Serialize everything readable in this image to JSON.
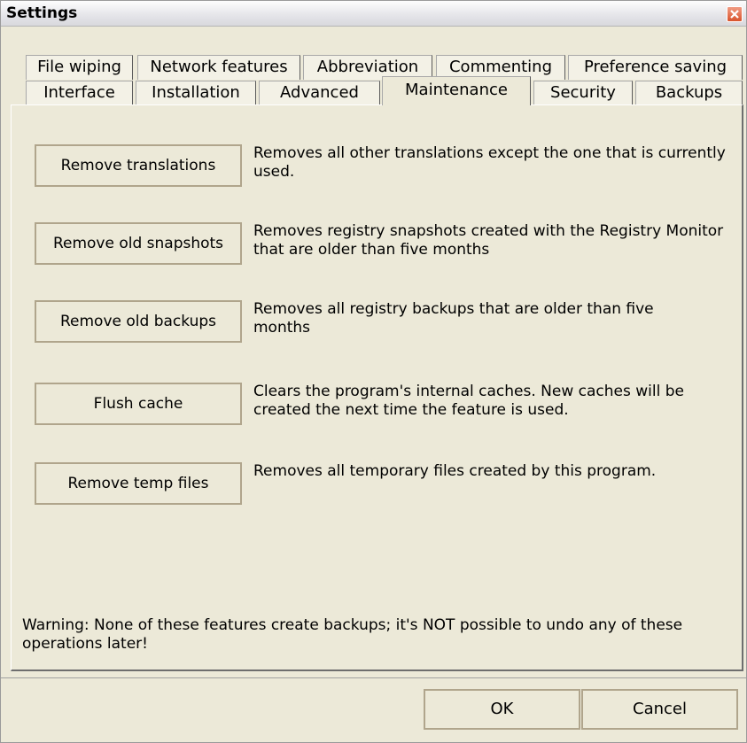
{
  "window": {
    "title": "Settings"
  },
  "tabs_row1": [
    "File wiping",
    "Network features",
    "Abbreviation",
    "Commenting",
    "Preference saving"
  ],
  "tabs_row2": [
    "Interface",
    "Installation",
    "Advanced",
    "Maintenance",
    "Security",
    "Backups"
  ],
  "active_tab": "Maintenance",
  "actions": [
    {
      "label": "Remove translations",
      "description": "Removes all other translations except the one that is currently used."
    },
    {
      "label": "Remove old snapshots",
      "description": "Removes registry snapshots created with the Registry Monitor that are older than five months"
    },
    {
      "label": "Remove old backups",
      "description": "Removes all registry backups that are older than five months"
    },
    {
      "label": "Flush cache",
      "description": "Clears the program's internal caches. New caches will be created the next time the feature is used."
    },
    {
      "label": "Remove temp files",
      "description": "Removes all temporary files created by this program."
    }
  ],
  "warning": "Warning: None of these features create backups; it's NOT possible to undo any of these operations later!",
  "footer": {
    "ok_label": "OK",
    "cancel_label": "Cancel"
  },
  "icons": {
    "close": "close-icon"
  },
  "colors": {
    "close_button": "#d9532c",
    "background": "#ece9d8"
  }
}
